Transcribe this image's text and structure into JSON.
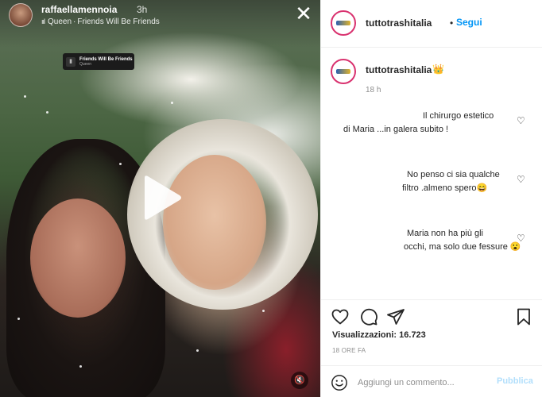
{
  "story": {
    "username": "raffaellamennoia",
    "time": "3h",
    "music_artist": "Queen",
    "music_separator": "·",
    "music_title": "Friends Will Be Friends",
    "sticker_title": "Friends Will Be Friends",
    "sticker_artist": "Queen"
  },
  "header": {
    "username": "tuttotrashitalia",
    "dot": "•",
    "follow_label": "Segui"
  },
  "caption": {
    "username": "tuttotrashitalia",
    "emoji": "👑",
    "time": "18 h"
  },
  "comments": [
    {
      "line1": "Il chirurgo estetico",
      "line2": "di Maria ...in galera subito !"
    },
    {
      "line1": "No penso ci sia qualche",
      "line2": "filtro .almeno spero😄"
    },
    {
      "line1": "Maria non ha più gli",
      "line2": "occhi, ma solo due fessure 😮"
    }
  ],
  "stats": {
    "views_label": "Visualizzazioni: 16.723",
    "time_ago": "18 ORE FA"
  },
  "add_comment": {
    "placeholder": "Aggiungi un commento...",
    "publish_label": "Pubblica"
  },
  "colors": {
    "accent_blue": "#0095f6",
    "publish_disabled": "#b2dffc",
    "text": "#262626",
    "muted": "#8e8e8e",
    "border": "#efefef"
  },
  "icons": [
    "close-icon",
    "play-icon",
    "mute-icon",
    "heart-icon",
    "comment-icon",
    "share-icon",
    "bookmark-icon",
    "emoji-icon"
  ]
}
